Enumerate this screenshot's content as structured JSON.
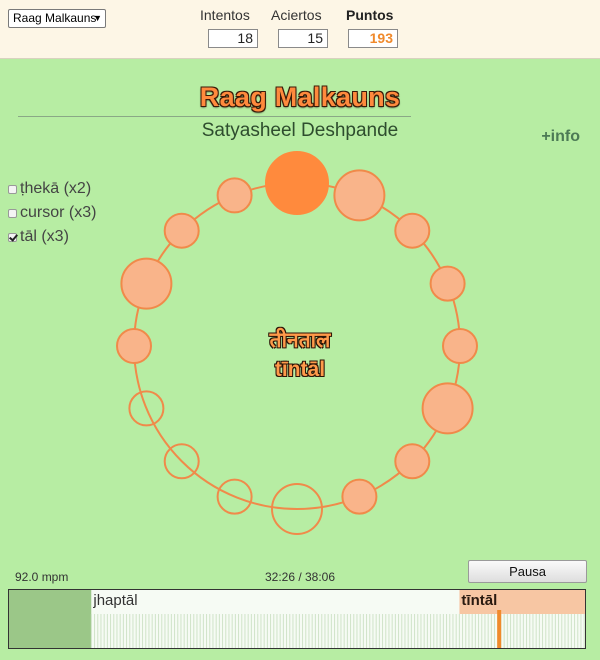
{
  "raag_select": {
    "value": "Raag Malkauns",
    "arrow": "▼"
  },
  "stats": {
    "attempts": {
      "label": "Intentos",
      "value": "18"
    },
    "hits": {
      "label": "Aciertos",
      "value": "15"
    },
    "points": {
      "label": "Puntos",
      "value": "193"
    }
  },
  "title": "Raag Malkauns",
  "artist": "Satyasheel Deshpande",
  "info_link": "+info",
  "options": [
    {
      "label": "ṭhekā (x2)",
      "checked": false
    },
    {
      "label": "cursor (x3)",
      "checked": false
    },
    {
      "label": "tāl (x3)",
      "checked": true
    }
  ],
  "tal": {
    "name_devanagari": "तीनताल",
    "name_latin": "tīntāl",
    "beats": 16,
    "current_beat": 0,
    "beat_states": [
      "active",
      "big",
      "filled",
      "filled",
      "filled",
      "big",
      "filled",
      "filled",
      "empty",
      "empty",
      "empty",
      "empty",
      "filled",
      "big",
      "filled",
      "filled"
    ]
  },
  "colors": {
    "accent": "#ff8a3d",
    "beat_fill": "#f9b48a",
    "beat_active": "#ff8a3d",
    "ring": "#f08a4a",
    "background": "#b7eda3",
    "header": "#fdf6e6"
  },
  "footer": {
    "tempo": "92.0 mpm",
    "time": "32:26 / 38:06",
    "pause_label": "Pausa"
  },
  "timeline": {
    "progress": 0.851,
    "segments": [
      {
        "label": "",
        "start": 0.0,
        "end": 0.143
      },
      {
        "label": "jhaptāl",
        "start": 0.143,
        "end": 0.782
      },
      {
        "label": "tīntāl",
        "start": 0.782,
        "end": 1.0,
        "active": true
      }
    ]
  }
}
